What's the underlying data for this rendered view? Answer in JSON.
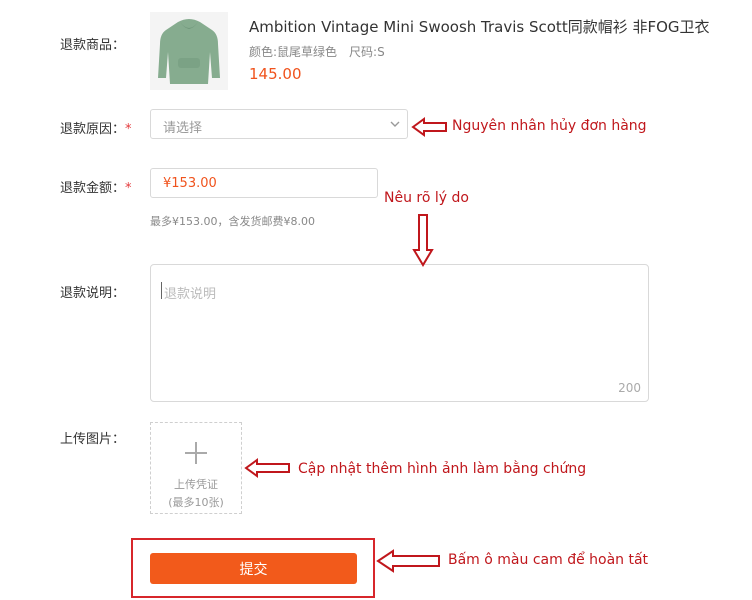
{
  "product": {
    "label": "退款商品：",
    "title": "Ambition Vintage Mini Swoosh Travis Scott同款帽衫 非FOG卫衣",
    "color": "颜色:鼠尾草绿色",
    "size": "尺码:S",
    "price": "145.00",
    "image_color": "#86ac8f"
  },
  "reason": {
    "label": "退款原因：",
    "required_mark": "*",
    "placeholder": "请选择"
  },
  "amount": {
    "label": "退款金额：",
    "required_mark": "*",
    "value": "¥153.00",
    "hint": "最多¥153.00，含发货邮费¥8.00"
  },
  "description": {
    "label": "退款说明：",
    "placeholder": "退款说明",
    "counter": "200"
  },
  "upload": {
    "label": "上传图片：",
    "text": "上传凭证",
    "subtext": "(最多10张)"
  },
  "submit": {
    "label": "提交"
  },
  "annotations": {
    "reason": "Nguyên nhân hủy đơn hàng",
    "explain": "Nêu rõ lý do",
    "upload": "Cập nhật thêm hình ảnh làm bằng chứng",
    "submit": "Bấm ô màu cam để hoàn tất",
    "color": "#c0171c"
  },
  "colors": {
    "accent": "#f25a1b",
    "price": "#f0531d",
    "required": "#e4393c"
  }
}
